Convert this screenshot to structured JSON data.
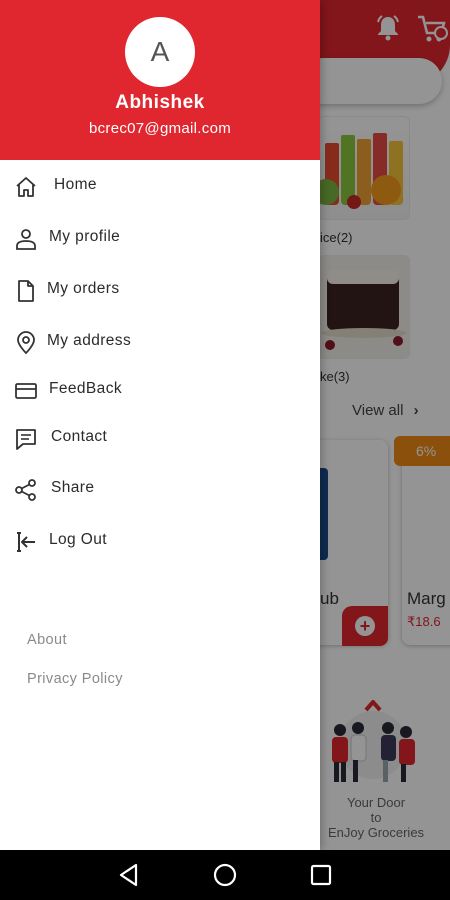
{
  "drawer": {
    "avatar_initial": "A",
    "user_name": "Abhishek",
    "user_email": "bcrec07@gmail.com",
    "menu": [
      {
        "label": "Home",
        "icon": "home-icon"
      },
      {
        "label": "My profile",
        "icon": "person-icon"
      },
      {
        "label": "My orders",
        "icon": "document-icon"
      },
      {
        "label": "My address",
        "icon": "location-pin-icon"
      },
      {
        "label": "FeedBack",
        "icon": "feedback-icon"
      },
      {
        "label": "Contact",
        "icon": "chat-icon"
      },
      {
        "label": "Share",
        "icon": "share-icon"
      },
      {
        "label": "Log Out",
        "icon": "logout-icon"
      }
    ],
    "footer_links": [
      "About",
      "Privacy Policy"
    ]
  },
  "background": {
    "categories": [
      {
        "label": "ice(2)",
        "name": "Juice"
      },
      {
        "label": "ke(3)",
        "name": "Cake"
      }
    ],
    "view_all": "View all",
    "discount_badge": "6% ",
    "product_partial_1": "ub",
    "product_partial_2": "Marg",
    "price_partial": "₹18.6",
    "promo_lines": [
      "Your Door",
      "to",
      "EnJoy Groceries"
    ]
  },
  "colors": {
    "brand_red": "#e0272f",
    "discount_orange": "#f08a16",
    "nav_bar": "#000000"
  }
}
